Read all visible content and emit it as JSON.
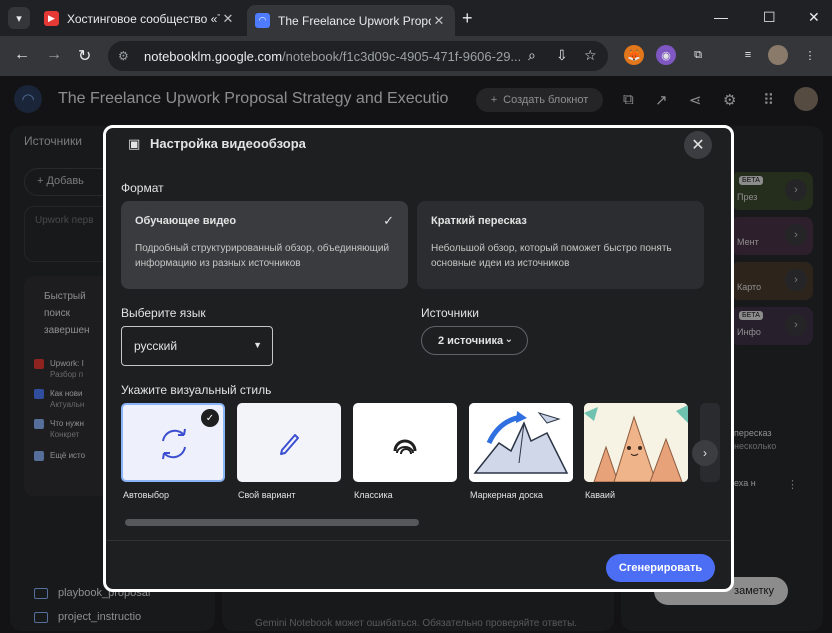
{
  "browser": {
    "tabs": [
      {
        "title": "Хостинговое сообщество «Tim",
        "favicon_color": "#e53935",
        "active": false
      },
      {
        "title": "The Freelance Upwork Proposal",
        "favicon_color": "#4f7cff",
        "active": true
      }
    ],
    "url_host": "notebooklm.google.com",
    "url_path": "/notebook/f1c3d09c-4905-471f-9606-29..."
  },
  "app": {
    "notebook_title": "The Freelance Upwork Proposal Strategy and Execution Pl",
    "create_button": "Создать блокнот",
    "footer_note": "Gemini Notebook может ошибаться. Обязательно проверяйте ответы."
  },
  "sources_panel": {
    "title": "Источники",
    "add_label": "+ Добавь",
    "search_placeholder": "Upwork перв",
    "fast_search": "Быстрый поиск завершен",
    "items": [
      {
        "title": "Upwork: I",
        "subtitle": "Разбор п",
        "color": "#e53935"
      },
      {
        "title": "Как нови",
        "subtitle": "Актуальн",
        "color": "#4f7cff"
      },
      {
        "title": "Что нужн",
        "subtitle": "Конкрет",
        "color": "#8ab4f8"
      },
      {
        "title": "Ещё исто",
        "subtitle": "",
        "color": "#8ab4f8"
      }
    ],
    "files": [
      "playbook_proposal",
      "project_instructio"
    ]
  },
  "studio_panel": {
    "items": [
      {
        "label": "През",
        "badge": "БЕТА",
        "color": "#3d4a2e"
      },
      {
        "label": "Мент",
        "badge": "",
        "color": "#4a3347"
      },
      {
        "label": "Карто",
        "badge": "",
        "color": "#4a3a2e"
      },
      {
        "label": "Инфо",
        "badge": "БЕТА",
        "color": "#3f3347"
      }
    ],
    "notes": [
      "пересказ",
      "несколько",
      "еха н"
    ],
    "add_note": "заметку"
  },
  "modal": {
    "title": "Настройка видеообзора",
    "format_label": "Формат",
    "formats": [
      {
        "name": "Обучающее видео",
        "desc": "Подробный структурированный обзор, объединяющий информацию из разных источников",
        "selected": true
      },
      {
        "name": "Краткий пересказ",
        "desc": "Небольшой обзор, который поможет быстро понять основные идеи из источников",
        "selected": false
      }
    ],
    "language_label": "Выберите язык",
    "language_value": "русский",
    "sources_label": "Источники",
    "sources_value": "2 источника",
    "style_label": "Укажите визуальный стиль",
    "styles": [
      {
        "name": "Автовыбор",
        "selected": true
      },
      {
        "name": "Свой вариант",
        "selected": false
      },
      {
        "name": "Классика",
        "selected": false
      },
      {
        "name": "Маркерная доска",
        "selected": false
      },
      {
        "name": "Каваий",
        "selected": false
      }
    ],
    "generate_button": "Сгенерировать"
  }
}
